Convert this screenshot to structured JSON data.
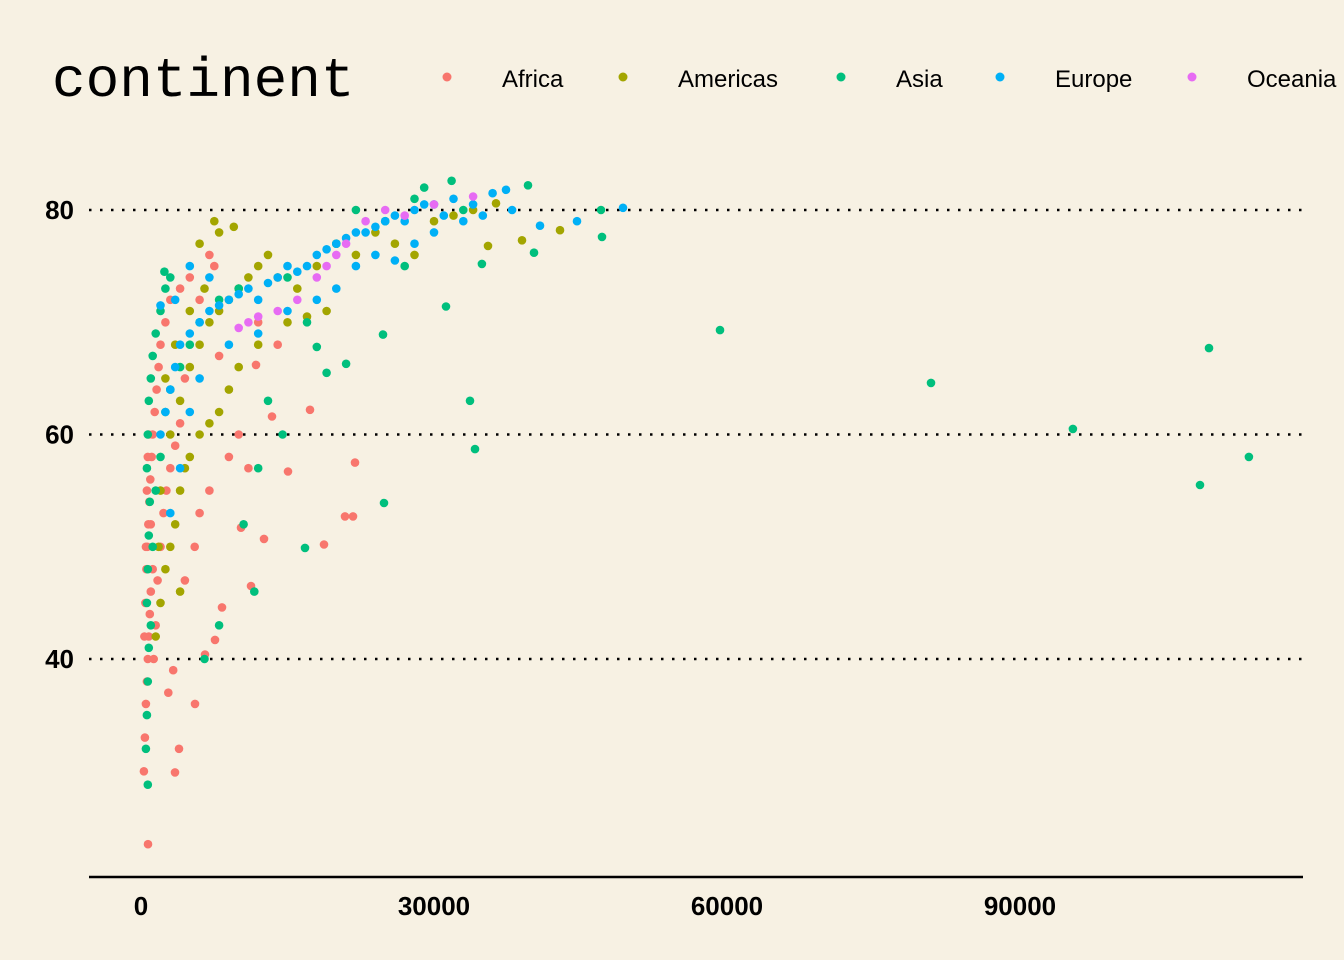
{
  "chart_data": {
    "type": "scatter",
    "title": "",
    "xlabel": "",
    "ylabel": "",
    "xlim": [
      -5300,
      119000
    ],
    "ylim": [
      20.6,
      86
    ],
    "x_ticks": [
      "0",
      "30000",
      "60000",
      "90000"
    ],
    "x_tick_values": [
      0,
      30000,
      60000,
      90000
    ],
    "y_ticks": [
      "40",
      "60",
      "80"
    ],
    "y_tick_values": [
      40,
      60,
      80
    ],
    "grid": "horizontal dotted",
    "legend": {
      "title": "continent",
      "placement": "top"
    },
    "background": "#F7F1E3",
    "series": [
      {
        "name": "Africa",
        "color": "#F8766D",
        "points": [
          [
            300,
            30
          ],
          [
            400,
            33
          ],
          [
            500,
            36
          ],
          [
            600,
            38
          ],
          [
            700,
            40
          ],
          [
            800,
            42
          ],
          [
            900,
            44
          ],
          [
            1000,
            46
          ],
          [
            350,
            42
          ],
          [
            450,
            45
          ],
          [
            550,
            48
          ],
          [
            650,
            50
          ],
          [
            750,
            52
          ],
          [
            850,
            54
          ],
          [
            950,
            56
          ],
          [
            1100,
            58
          ],
          [
            1200,
            60
          ],
          [
            1400,
            62
          ],
          [
            1600,
            64
          ],
          [
            1800,
            66
          ],
          [
            2000,
            68
          ],
          [
            2500,
            70
          ],
          [
            3000,
            72
          ],
          [
            4000,
            73
          ],
          [
            5000,
            74
          ],
          [
            6000,
            72
          ],
          [
            7000,
            76
          ],
          [
            7500,
            75
          ],
          [
            1300,
            40
          ],
          [
            1500,
            43
          ],
          [
            1700,
            47
          ],
          [
            2000,
            50
          ],
          [
            2300,
            53
          ],
          [
            2600,
            55
          ],
          [
            3000,
            57
          ],
          [
            3500,
            59
          ],
          [
            4000,
            61
          ],
          [
            500,
            50
          ],
          [
            600,
            55
          ],
          [
            700,
            58
          ],
          [
            800,
            60
          ],
          [
            1000,
            52
          ],
          [
            1200,
            48
          ],
          [
            720,
            23.5
          ],
          [
            3480,
            29.9
          ],
          [
            3890,
            32
          ],
          [
            5530,
            36
          ],
          [
            6550,
            40.4
          ],
          [
            21910,
            57.5
          ],
          [
            21710,
            52.7
          ],
          [
            20890,
            52.7
          ],
          [
            18740,
            50.2
          ],
          [
            17300,
            62.2
          ],
          [
            15050,
            56.7
          ],
          [
            13410,
            61.6
          ],
          [
            11770,
            66.2
          ],
          [
            12590,
            50.7
          ],
          [
            11260,
            46.5
          ],
          [
            10240,
            51.7
          ],
          [
            7580,
            41.7
          ],
          [
            8290,
            44.6
          ],
          [
            2800,
            37
          ],
          [
            3300,
            39
          ],
          [
            4500,
            47
          ],
          [
            5500,
            50
          ],
          [
            6000,
            53
          ],
          [
            7000,
            55
          ],
          [
            9000,
            58
          ],
          [
            10000,
            60
          ],
          [
            11000,
            57
          ],
          [
            14000,
            68
          ],
          [
            12000,
            70
          ],
          [
            8000,
            67
          ],
          [
            4500,
            65
          ]
        ]
      },
      {
        "name": "Americas",
        "color": "#A3A500",
        "points": [
          [
            1500,
            42
          ],
          [
            2000,
            45
          ],
          [
            2500,
            48
          ],
          [
            3000,
            50
          ],
          [
            3500,
            52
          ],
          [
            4000,
            55
          ],
          [
            4500,
            57
          ],
          [
            5000,
            58
          ],
          [
            6000,
            60
          ],
          [
            7000,
            61
          ],
          [
            8000,
            62
          ],
          [
            9000,
            64
          ],
          [
            10000,
            66
          ],
          [
            3000,
            60
          ],
          [
            4000,
            63
          ],
          [
            5000,
            66
          ],
          [
            6000,
            68
          ],
          [
            7000,
            70
          ],
          [
            8000,
            71
          ],
          [
            9000,
            72
          ],
          [
            10000,
            73
          ],
          [
            11000,
            74
          ],
          [
            12000,
            75
          ],
          [
            13000,
            76
          ],
          [
            14000,
            74
          ],
          [
            16000,
            73
          ],
          [
            18000,
            75
          ],
          [
            20000,
            77
          ],
          [
            22000,
            76
          ],
          [
            24000,
            78
          ],
          [
            26000,
            77
          ],
          [
            28000,
            76
          ],
          [
            30000,
            79
          ],
          [
            32000,
            79.5
          ],
          [
            34000,
            80
          ],
          [
            36350,
            80.6
          ],
          [
            39010,
            77.3
          ],
          [
            35530,
            76.8
          ],
          [
            42900,
            78.2
          ],
          [
            8000,
            78
          ],
          [
            9500,
            78.5
          ],
          [
            6000,
            77
          ],
          [
            7500,
            79
          ],
          [
            2500,
            65
          ],
          [
            3500,
            68
          ],
          [
            5000,
            71
          ],
          [
            6500,
            73
          ],
          [
            2000,
            55
          ],
          [
            1800,
            50
          ],
          [
            4000,
            46
          ],
          [
            12000,
            68
          ],
          [
            15000,
            70
          ],
          [
            17000,
            70.5
          ],
          [
            19000,
            71
          ]
        ]
      },
      {
        "name": "Asia",
        "color": "#00BF7D",
        "points": [
          [
            700,
            28.8
          ],
          [
            500,
            32
          ],
          [
            600,
            35
          ],
          [
            700,
            38
          ],
          [
            800,
            41
          ],
          [
            600,
            45
          ],
          [
            700,
            48
          ],
          [
            800,
            51
          ],
          [
            900,
            54
          ],
          [
            600,
            57
          ],
          [
            700,
            60
          ],
          [
            800,
            63
          ],
          [
            1000,
            65
          ],
          [
            1200,
            67
          ],
          [
            1500,
            69
          ],
          [
            2000,
            71
          ],
          [
            2500,
            73
          ],
          [
            3000,
            74
          ],
          [
            1000,
            43
          ],
          [
            1200,
            50
          ],
          [
            1500,
            55
          ],
          [
            2000,
            58
          ],
          [
            2500,
            62
          ],
          [
            3000,
            64
          ],
          [
            4000,
            66
          ],
          [
            5000,
            68
          ],
          [
            6000,
            70
          ],
          [
            8000,
            72
          ],
          [
            10000,
            73
          ],
          [
            15000,
            74
          ],
          [
            20000,
            77
          ],
          [
            25000,
            79
          ],
          [
            28000,
            81
          ],
          [
            29000,
            82
          ],
          [
            31800,
            82.6
          ],
          [
            33000,
            80
          ],
          [
            2400,
            74.5
          ],
          [
            6500,
            40
          ],
          [
            8000,
            43
          ],
          [
            11600,
            46
          ],
          [
            10500,
            52
          ],
          [
            12000,
            57
          ],
          [
            14500,
            60
          ],
          [
            13000,
            63
          ],
          [
            18000,
            67.8
          ],
          [
            19000,
            65.5
          ],
          [
            21000,
            66.3
          ],
          [
            17000,
            70
          ],
          [
            59280,
            69.3
          ],
          [
            80890,
            64.6
          ],
          [
            95420,
            60.5
          ],
          [
            109350,
            67.7
          ],
          [
            108430,
            55.5
          ],
          [
            113440,
            58
          ],
          [
            24780,
            68.9
          ],
          [
            24880,
            53.9
          ],
          [
            33690,
            63
          ],
          [
            34200,
            58.7
          ],
          [
            31230,
            71.4
          ],
          [
            16790,
            49.9
          ],
          [
            47100,
            80
          ],
          [
            47200,
            77.6
          ],
          [
            39620,
            82.2
          ],
          [
            40240,
            76.2
          ],
          [
            34900,
            75.2
          ],
          [
            27000,
            75
          ],
          [
            22000,
            80
          ]
        ]
      },
      {
        "name": "Europe",
        "color": "#00B0F6",
        "points": [
          [
            2000,
            60
          ],
          [
            2500,
            62
          ],
          [
            3000,
            64
          ],
          [
            3500,
            66
          ],
          [
            4000,
            68
          ],
          [
            5000,
            69
          ],
          [
            6000,
            70
          ],
          [
            7000,
            71
          ],
          [
            8000,
            71.5
          ],
          [
            9000,
            72
          ],
          [
            10000,
            72.5
          ],
          [
            11000,
            73
          ],
          [
            12000,
            72
          ],
          [
            13000,
            73.5
          ],
          [
            14000,
            74
          ],
          [
            15000,
            75
          ],
          [
            16000,
            74.5
          ],
          [
            17000,
            75
          ],
          [
            18000,
            76
          ],
          [
            19000,
            76.5
          ],
          [
            20000,
            77
          ],
          [
            21000,
            77.5
          ],
          [
            22000,
            78
          ],
          [
            23000,
            78
          ],
          [
            24000,
            78.5
          ],
          [
            25000,
            79
          ],
          [
            26000,
            79.5
          ],
          [
            27000,
            79
          ],
          [
            28000,
            80
          ],
          [
            29000,
            80.5
          ],
          [
            30000,
            80.5
          ],
          [
            31000,
            79.5
          ],
          [
            32000,
            81
          ],
          [
            34000,
            80.5
          ],
          [
            36000,
            81.5
          ],
          [
            37370,
            81.8
          ],
          [
            40850,
            78.6
          ],
          [
            44640,
            79
          ],
          [
            49350,
            80.2
          ],
          [
            3000,
            53
          ],
          [
            4000,
            57
          ],
          [
            5000,
            62
          ],
          [
            6000,
            65
          ],
          [
            5000,
            75
          ],
          [
            7000,
            74
          ],
          [
            3500,
            72
          ],
          [
            12000,
            69
          ],
          [
            15000,
            71
          ],
          [
            18000,
            72
          ],
          [
            20000,
            73
          ],
          [
            9000,
            68
          ],
          [
            2000,
            71.5
          ],
          [
            22000,
            75
          ],
          [
            24000,
            76
          ],
          [
            26000,
            75.5
          ],
          [
            28000,
            77
          ],
          [
            30000,
            78
          ],
          [
            33000,
            79
          ],
          [
            35000,
            79.5
          ],
          [
            38000,
            80
          ]
        ]
      },
      {
        "name": "Oceania",
        "color": "#E76BF3",
        "points": [
          [
            10000,
            69.5
          ],
          [
            12000,
            70.5
          ],
          [
            14000,
            71
          ],
          [
            16000,
            72
          ],
          [
            18000,
            74
          ],
          [
            20000,
            76
          ],
          [
            21000,
            77
          ],
          [
            23000,
            79
          ],
          [
            25000,
            80
          ],
          [
            27000,
            79.5
          ],
          [
            30000,
            80.5
          ],
          [
            34000,
            81.2
          ],
          [
            11000,
            70
          ],
          [
            19000,
            75
          ]
        ]
      }
    ]
  }
}
